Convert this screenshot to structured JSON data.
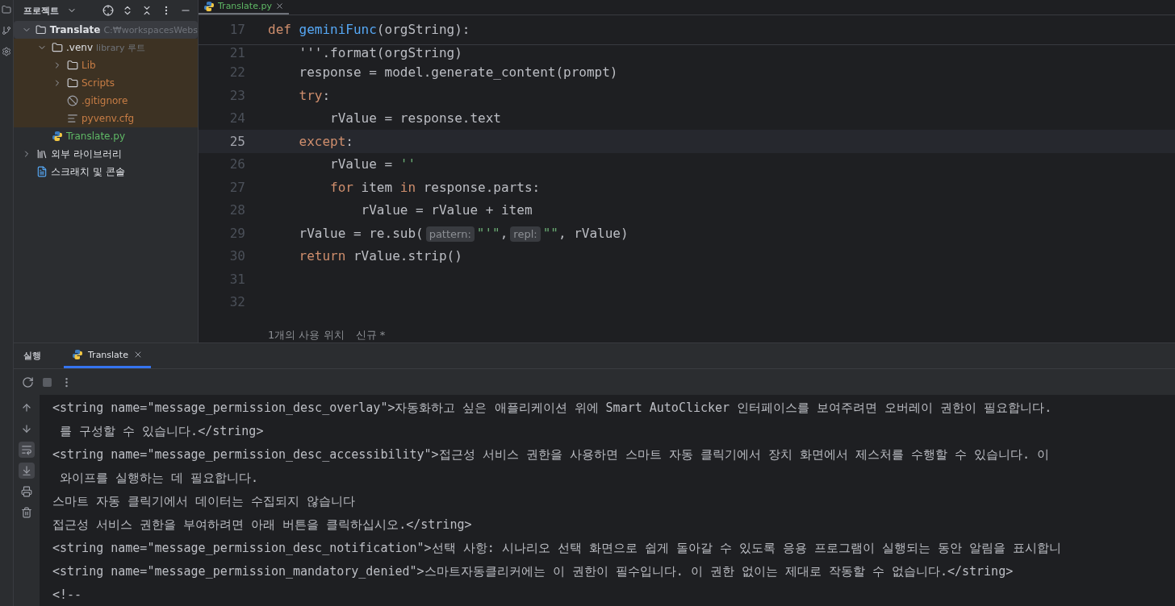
{
  "sidebar": {
    "title": "프로젝트",
    "tree": [
      {
        "kind": "folder",
        "label": "Translate",
        "hint": "C:₩workspacesWebs",
        "expanded": true,
        "selected": true,
        "children": [
          {
            "kind": "folder",
            "label": ".venv",
            "hint": "library 루트",
            "expanded": true,
            "selected": false,
            "library": true,
            "children": [
              {
                "kind": "folder",
                "label": "Lib",
                "expanded": false,
                "selected": false
              },
              {
                "kind": "folder",
                "label": "Scripts",
                "expanded": false,
                "selected": false
              },
              {
                "kind": "ignore",
                "label": ".gitignore",
                "selected": false
              },
              {
                "kind": "config",
                "label": "pyvenv.cfg",
                "selected": false
              }
            ]
          },
          {
            "kind": "python",
            "label": "Translate.py",
            "selected": false,
            "added": true
          }
        ]
      },
      {
        "kind": "library",
        "label": "외부 라이브러리",
        "expanded": false,
        "selected": false
      },
      {
        "kind": "scratch",
        "label": "스크래치 및 콘솔",
        "selected": false
      }
    ]
  },
  "editor": {
    "tabs": [
      {
        "label": "Translate.py",
        "selected": true
      }
    ],
    "sticky": {
      "number": "17",
      "tokens": [
        {
          "kind": "kw",
          "t": "def "
        },
        {
          "kind": "fn",
          "t": "geminiFunc"
        },
        {
          "kind": "p",
          "t": "(orgString):"
        }
      ]
    },
    "lines": [
      {
        "number": "21",
        "current": false,
        "tokens": [
          {
            "kind": "p",
            "t": "    '''.format(orgString)"
          }
        ]
      },
      {
        "number": "22",
        "current": false,
        "tokens": [
          {
            "kind": "p",
            "t": "    response = model.generate_content(prompt)"
          }
        ]
      },
      {
        "number": "23",
        "current": false,
        "tokens": [
          {
            "kind": "kw",
            "t": "    try"
          },
          {
            "kind": "p",
            "t": ":"
          }
        ]
      },
      {
        "number": "24",
        "current": false,
        "tokens": [
          {
            "kind": "p",
            "t": "        rValue = response.text"
          }
        ]
      },
      {
        "number": "25",
        "current": true,
        "tokens": [
          {
            "kind": "kw",
            "t": "    except"
          },
          {
            "kind": "p",
            "t": ":"
          }
        ]
      },
      {
        "number": "26",
        "current": false,
        "tokens": [
          {
            "kind": "p",
            "t": "        rValue = "
          },
          {
            "kind": "str",
            "t": "''"
          }
        ]
      },
      {
        "number": "27",
        "current": false,
        "tokens": [
          {
            "kind": "kw",
            "t": "        for "
          },
          {
            "kind": "p",
            "t": "item "
          },
          {
            "kind": "kw",
            "t": "in "
          },
          {
            "kind": "p",
            "t": "response.parts:"
          }
        ]
      },
      {
        "number": "28",
        "current": false,
        "tokens": [
          {
            "kind": "p",
            "t": "            rValue = rValue + item"
          }
        ]
      },
      {
        "number": "29",
        "current": false,
        "tokens": [
          {
            "kind": "p",
            "t": "    rValue = re.sub("
          },
          {
            "kind": "hint",
            "t": "pattern:"
          },
          {
            "kind": "str",
            "t": "\"'\""
          },
          {
            "kind": "p",
            "t": ","
          },
          {
            "kind": "hint",
            "t": "repl:"
          },
          {
            "kind": "str",
            "t": "\"\""
          },
          {
            "kind": "p",
            "t": ", rValue)"
          }
        ]
      },
      {
        "number": "30",
        "current": false,
        "tokens": [
          {
            "kind": "kw",
            "t": "    return "
          },
          {
            "kind": "p",
            "t": "rValue.strip()"
          }
        ]
      },
      {
        "number": "31",
        "current": false
      },
      {
        "number": "32",
        "current": false
      }
    ],
    "usages": "1개의 사용 위치",
    "author": "신규 *"
  },
  "run": {
    "title": "실행",
    "tabs": [
      {
        "label": "Translate",
        "selected": true
      }
    ],
    "lines": [
      "<string name=\"message_permission_desc_overlay\">자동화하고 싶은 애플리케이션 위에 Smart AutoClicker 인터페이스를 보여주려면 오버레이 권한이 필요합니다.",
      " 를 구성할 수 있습니다.</string>",
      "<string name=\"message_permission_desc_accessibility\">접근성 서비스 권한을 사용하면 스마트 자동 클릭기에서 장치 화면에서 제스처를 수행할 수 있습니다. 이",
      " 와이프를 실행하는 데 필요합니다.",
      "스마트 자동 클릭기에서 데이터는 수집되지 않습니다",
      "접근성 서비스 권한을 부여하려면 아래 버튼을 클릭하십시오.</string>",
      "<string name=\"message_permission_desc_notification\">선택 사항: 시나리오 선택 화면으로 쉽게 돌아갈 수 있도록 응용 프로그램이 실행되는 동안 알림을 표시합니",
      "<string name=\"message_permission_mandatory_denied\">스마트자동클리커에는 이 권한이 필수입니다. 이 권한 없이는 제대로 작동할 수 없습니다.</string>",
      "<!--"
    ]
  }
}
